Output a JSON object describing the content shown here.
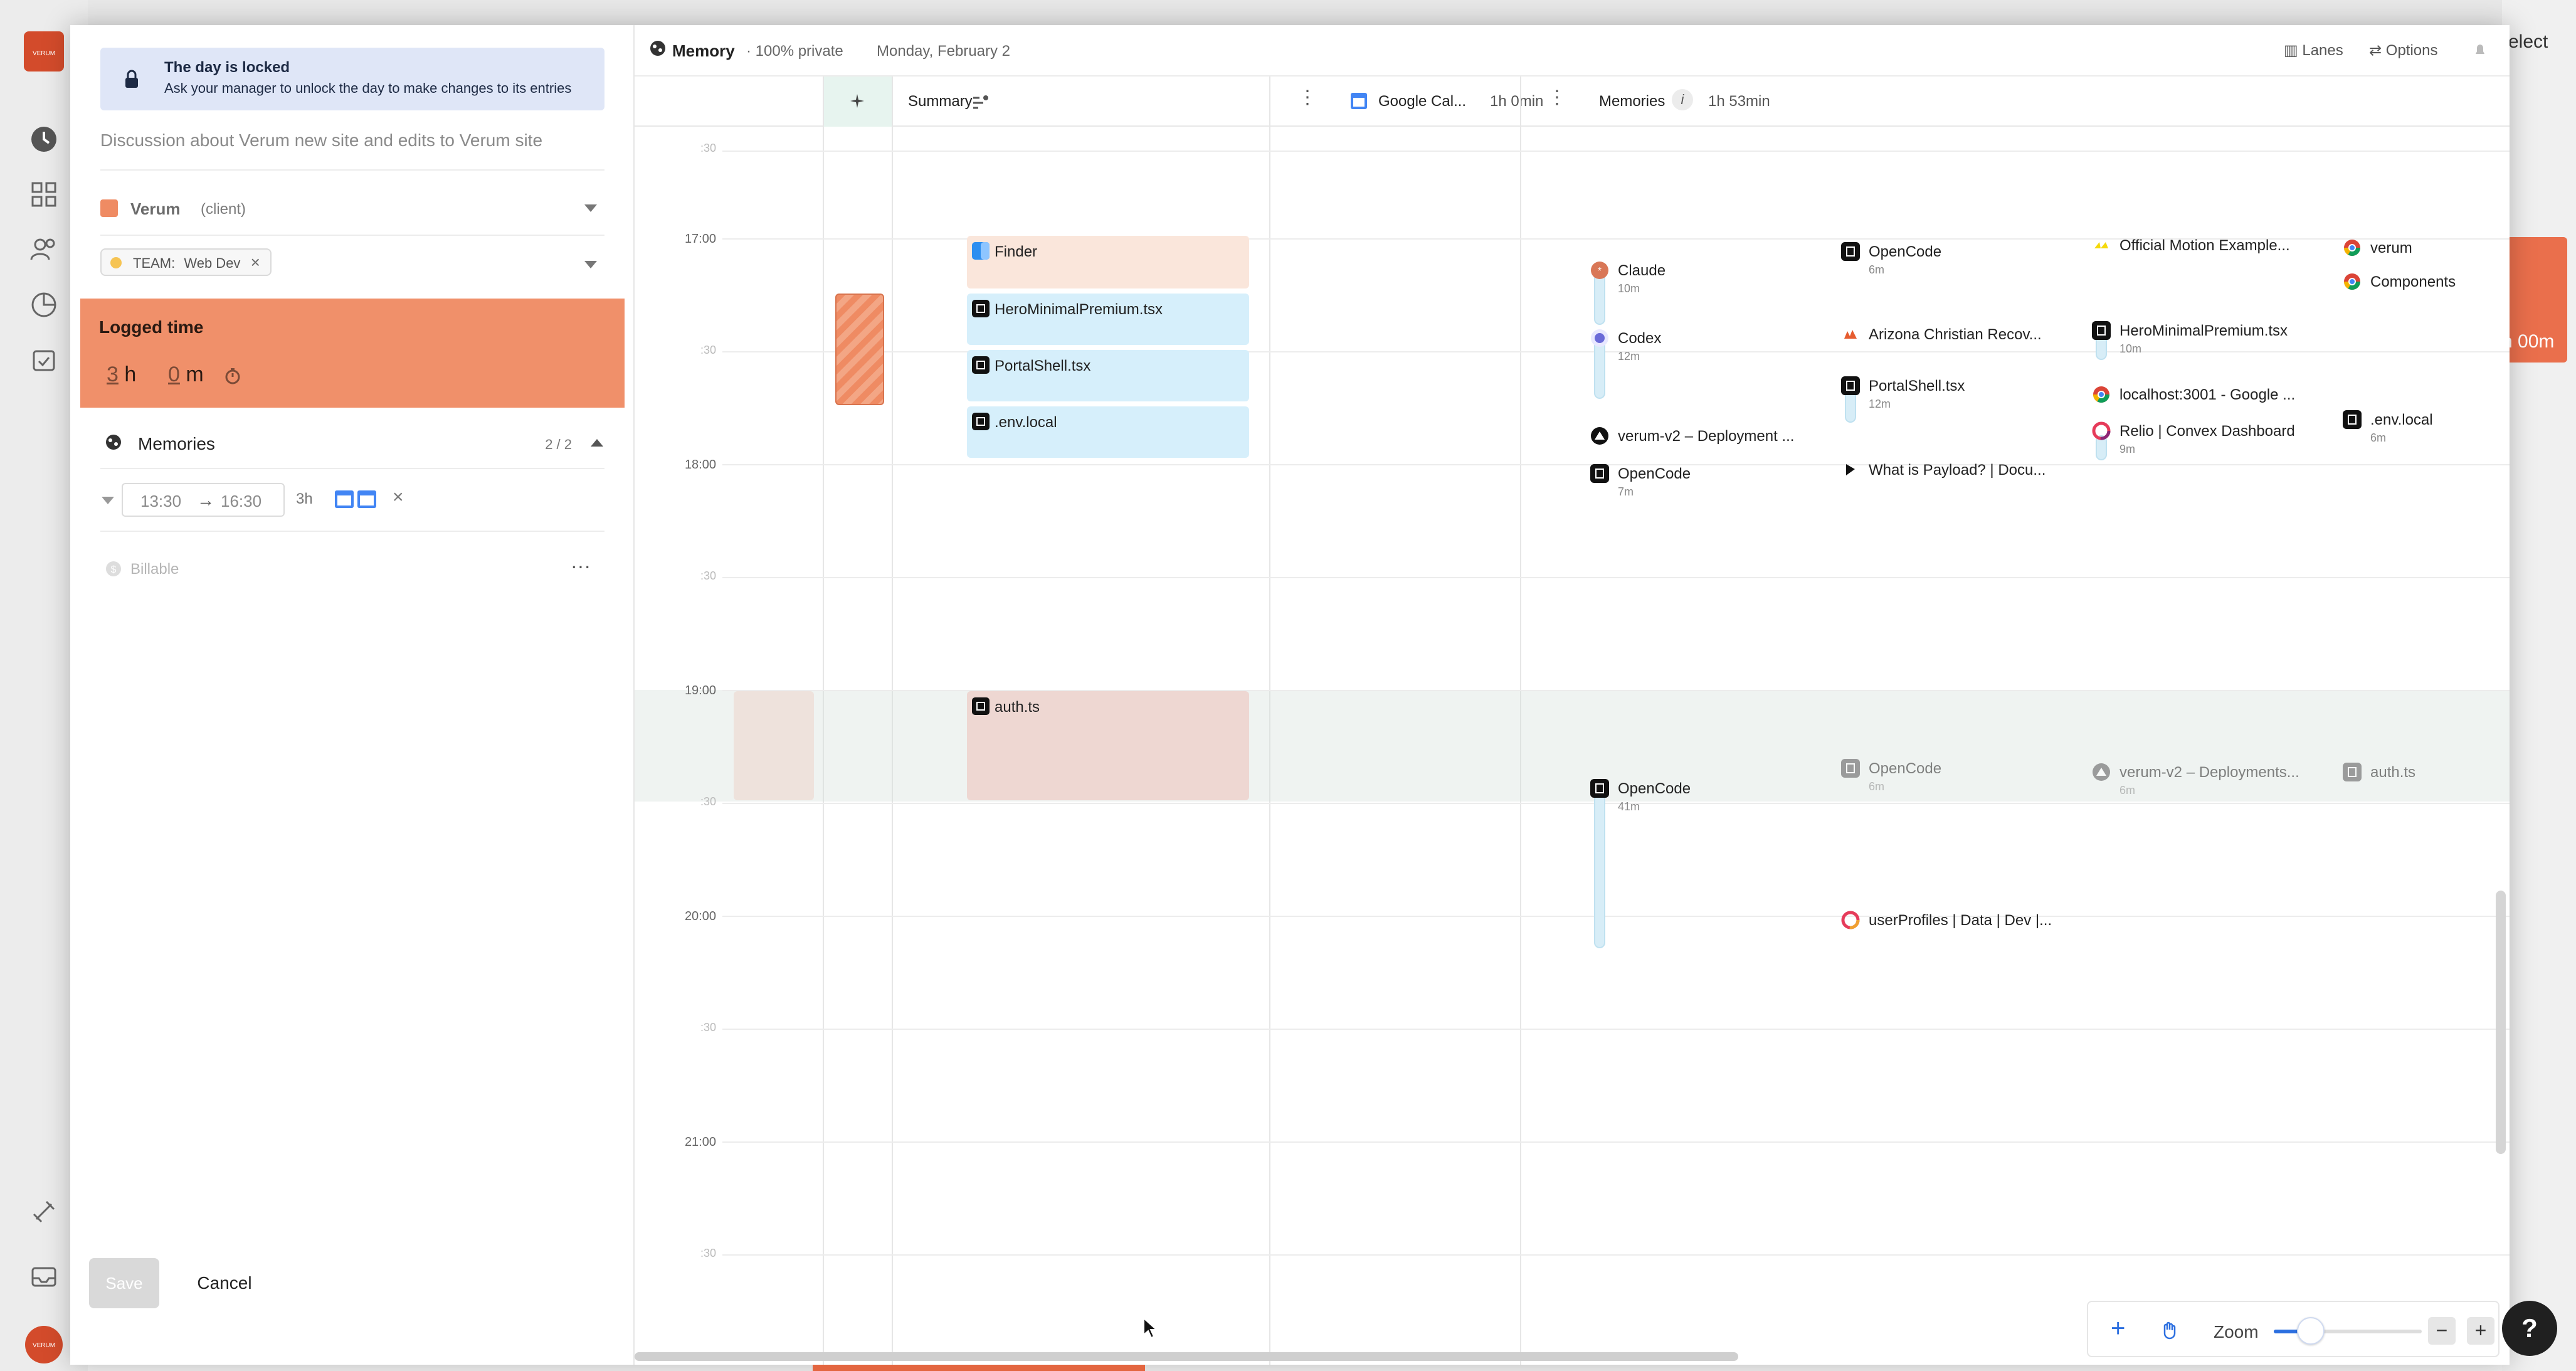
{
  "background": {
    "right_partial_text": "elect",
    "right_partial_badge": "h 00m",
    "logo_text": "VERUM"
  },
  "left_panel": {
    "lock_banner": {
      "title": "The day is locked",
      "subtitle": "Ask your manager to unlock the day to make changes to its entries"
    },
    "description": "Discussion about Verum new site and edits to Verum site",
    "client": {
      "name": "Verum",
      "type": "(client)",
      "color": "#ef8b63"
    },
    "team_tag": {
      "label": "TEAM:",
      "value": "Web Dev",
      "remove": "×"
    },
    "logged_time": {
      "title": "Logged time",
      "hours": "3",
      "hours_unit": "h",
      "minutes": "0",
      "minutes_unit": "m"
    },
    "memories": {
      "title": "Memories",
      "count": "2 / 2"
    },
    "range": {
      "start": "13:30",
      "arrow": "→",
      "end": "16:30",
      "duration": "3h",
      "remove": "×"
    },
    "billable": {
      "label": "Billable",
      "more": "···"
    },
    "buttons": {
      "save": "Save",
      "cancel": "Cancel"
    }
  },
  "calendar": {
    "top": {
      "title": "Memory",
      "privacy": "· 100% private",
      "date": "Monday, February 2",
      "lanes": "Lanes",
      "options": "Options"
    },
    "columns": {
      "summary": "Summary",
      "google": "Google Cal...",
      "google_duration": "1h 0min",
      "memories": "Memories",
      "memories_info": "i",
      "memories_duration": "1h 53min",
      "more": "⋮"
    },
    "times": {
      "top_partial": ":30",
      "h17": "17:00",
      "h17_30": ":30",
      "h18": "18:00",
      "h18_30": ":30",
      "h19": "19:00",
      "h19_30": ":30",
      "h20": "20:00",
      "h20_30": ":30",
      "h21": "21:00",
      "h21_30": ":30"
    },
    "summary_events": [
      {
        "label": "Finder",
        "color": "#fae6db"
      },
      {
        "label": "HeroMinimalPremium.tsx",
        "color": "#d6effb"
      },
      {
        "label": "PortalShell.tsx",
        "color": "#d6effb"
      },
      {
        "label": ".env.local",
        "color": "#d6effb"
      },
      {
        "label": "auth.ts",
        "color": "#eed7d2"
      }
    ],
    "memory_items": {
      "claude": {
        "name": "Claude",
        "dur": "10m"
      },
      "codex": {
        "name": "Codex",
        "dur": "12m"
      },
      "vercel1": {
        "name": "verum-v2 – Deployment ..."
      },
      "opencode1": {
        "name": "OpenCode",
        "dur": "7m"
      },
      "opencode_big": {
        "name": "OpenCode",
        "dur": "41m"
      },
      "opencode2": {
        "name": "OpenCode",
        "dur": "6m"
      },
      "arizona": {
        "name": "Arizona Christian Recov..."
      },
      "portalshell": {
        "name": "PortalShell.tsx",
        "dur": "12m"
      },
      "payload": {
        "name": "What is Payload? | Docu..."
      },
      "opencode3": {
        "name": "OpenCode",
        "dur": "6m"
      },
      "userprofiles": {
        "name": "userProfiles | Data | Dev |..."
      },
      "motion": {
        "name": "Official Motion Example..."
      },
      "heromin": {
        "name": "HeroMinimalPremium.tsx",
        "dur": "10m"
      },
      "localhost": {
        "name": "localhost:3001 - Google ..."
      },
      "relio": {
        "name": "Relio | Convex Dashboard",
        "dur": "9m"
      },
      "vercel2": {
        "name": "verum-v2 – Deployments...",
        "dur": "6m"
      },
      "verum": {
        "name": "verum"
      },
      "components": {
        "name": "Components"
      },
      "envlocal": {
        "name": ".env.local",
        "dur": "6m"
      },
      "authts": {
        "name": "auth.ts"
      }
    }
  },
  "zoom": {
    "label": "Zoom",
    "plus": "+",
    "minus": "−",
    "level": 0.25
  },
  "help": "?"
}
